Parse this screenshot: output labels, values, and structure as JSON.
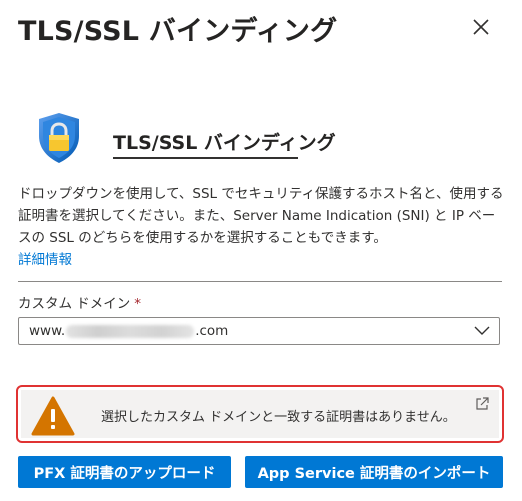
{
  "header": {
    "title": "TLS/SSL バインディング",
    "close_icon": "close-icon"
  },
  "hero": {
    "icon": "shield-lock-icon",
    "title": "TLS/SSL バインディング"
  },
  "description": {
    "text": "ドロップダウンを使用して、SSL でセキュリティ保護するホスト名と、使用する証明書を選択してください。また、Server Name Indication (SNI) と IP ベースの SSL のどちらを使用するかを選択することもできます。",
    "link": "詳細情報"
  },
  "custom_domain": {
    "label": "カスタム ドメイン",
    "required_mark": "*",
    "value_prefix": "www.",
    "value_suffix": ".com"
  },
  "warning": {
    "icon": "warning-icon",
    "text": "選択したカスタム ドメインと一致する証明書はありません。",
    "external_icon": "external-link-icon"
  },
  "buttons": {
    "upload_pfx": "PFX 証明書のアップロード",
    "import_app_service": "App Service 証明書のインポート"
  },
  "colors": {
    "accent": "#0078d4",
    "warning": "#d47500",
    "highlight_border": "#e03232",
    "shield": "#0078d4",
    "lock": "#f7c62f"
  }
}
